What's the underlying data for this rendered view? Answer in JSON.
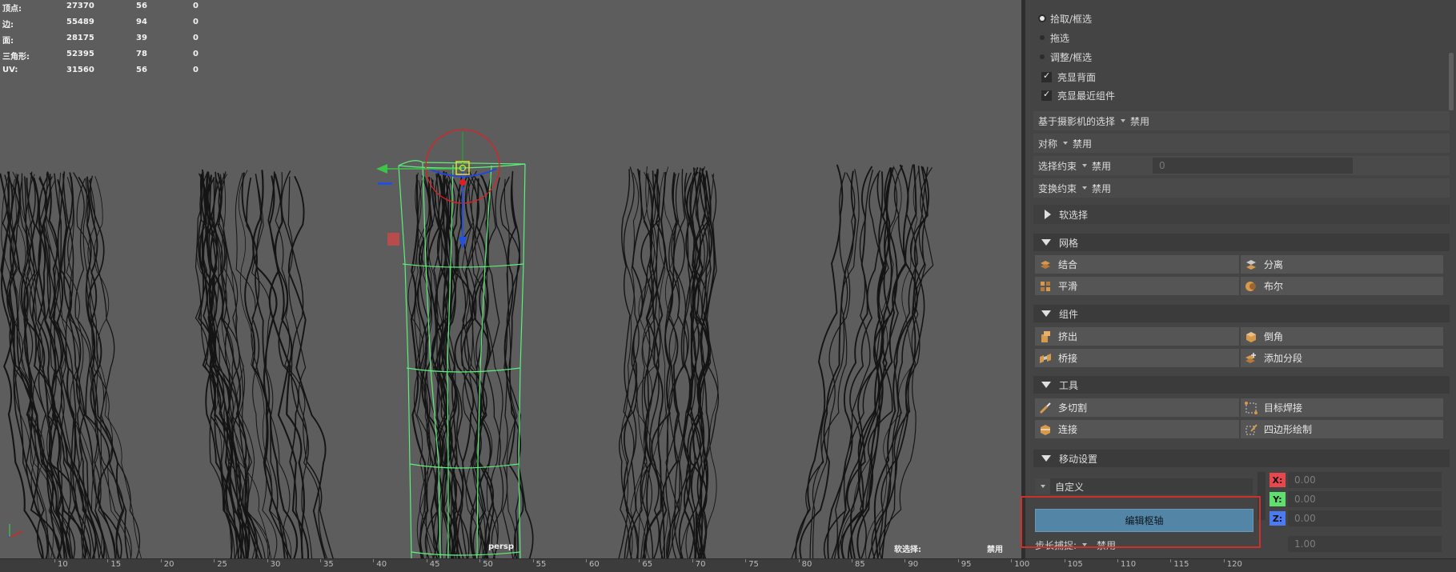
{
  "hud": {
    "rows": [
      {
        "label": "顶点:",
        "v1": "27370",
        "v2": "56",
        "v3": "0"
      },
      {
        "label": "边:",
        "v1": "55489",
        "v2": "94",
        "v3": "0"
      },
      {
        "label": "面:",
        "v1": "28175",
        "v2": "39",
        "v3": "0"
      },
      {
        "label": "三角形:",
        "v1": "52395",
        "v2": "78",
        "v3": "0"
      },
      {
        "label": "UV:",
        "v1": "31560",
        "v2": "56",
        "v3": "0"
      }
    ]
  },
  "viewport": {
    "camera_label": "persp",
    "soft_select_label": "软选择:",
    "soft_select_value": "禁用"
  },
  "timeline": {
    "ticks": [
      "10",
      "15",
      "20",
      "25",
      "30",
      "35",
      "40",
      "45",
      "50",
      "55",
      "60",
      "65",
      "70",
      "75",
      "80",
      "85",
      "90",
      "95",
      "100",
      "105",
      "110",
      "115",
      "120"
    ]
  },
  "panel": {
    "selection_modes": {
      "pick": "拾取/框选",
      "drag": "拖选",
      "tweak": "调整/框选"
    },
    "highlight_backface": "亮显背面",
    "highlight_nearest": "亮显最近组件",
    "camera_based_selection": {
      "label": "基于摄影机的选择",
      "value": "禁用"
    },
    "symmetry": {
      "label": "对称",
      "value": "禁用"
    },
    "select_constraint": {
      "label": "选择约束",
      "value": "禁用",
      "number": "0"
    },
    "transform_constraint": {
      "label": "变换约束",
      "value": "禁用"
    },
    "soft_selection": "软选择",
    "mesh_section": {
      "title": "网格",
      "combine": "结合",
      "separate": "分离",
      "smooth": "平滑",
      "boolean": "布尔"
    },
    "components_section": {
      "title": "组件",
      "extrude": "挤出",
      "bevel": "倒角",
      "bridge": "桥接",
      "add_divisions": "添加分段"
    },
    "tools_section": {
      "title": "工具",
      "multi_cut": "多切割",
      "target_weld": "目标焊接",
      "connect": "连接",
      "quad_draw": "四边形绘制"
    },
    "move_settings": {
      "title": "移动设置",
      "mode": "自定义",
      "x_label": "X:",
      "x_value": "0.00",
      "y_label": "Y:",
      "y_value": "0.00",
      "z_label": "Z:",
      "z_value": "0.00",
      "edit_pivot": "编辑枢轴",
      "step_snap": {
        "label": "步长捕捉:",
        "value": "禁用",
        "number": "1.00"
      }
    }
  },
  "colors": {
    "accent": "#5285a6",
    "x_axis": "#e8474d",
    "y_axis": "#5fe06e",
    "z_axis": "#4a7bf0",
    "wireframe": "#5cf07c",
    "highlight_box": "#d0302b"
  }
}
